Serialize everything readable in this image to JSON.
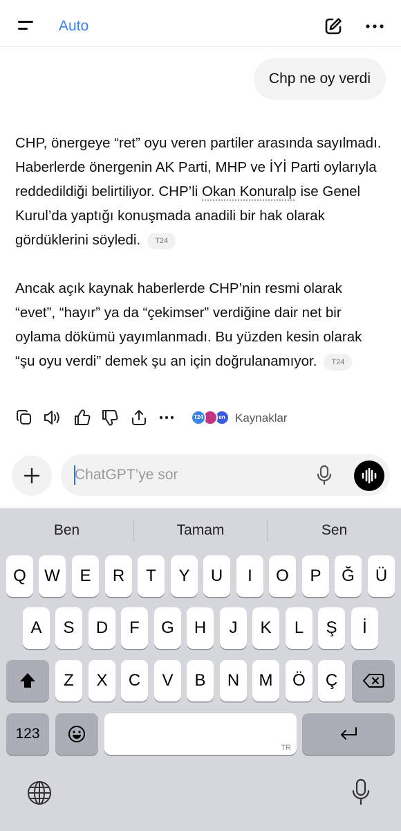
{
  "header": {
    "model_label": "Auto",
    "icons": {
      "menu": "menu-icon",
      "compose": "new-chat-icon",
      "more": "more-horizontal-icon"
    }
  },
  "conversation": {
    "user_message": "Chp ne oy verdi",
    "assistant": {
      "p1_text_a": "CHP, önergeye “ret” oyu veren partiler arasında sayılmadı. Haberlerde önergenin AK Parti, MHP ve İYİ Parti oylarıyla reddedildiği belirtiliyor. CHP’li ",
      "p1_link": "Okan Konuralp",
      "p1_text_b": " ise Genel Kurul’da yaptığı konuşmada anadili bir hak olarak gördüklerini söyledi.",
      "p1_cite": "T24",
      "p2_text": "Ancak açık kaynak haberlerde CHP’nin resmi olarak “evet”, “hayır” ya da “çekimser” verdiğine dair net bir oylama dökümü yayımlanmadı. Bu yüzden kesin olarak “şu oyu verdi” demek şu an için doğrulanamıyor.",
      "p2_cite": "T24"
    },
    "actions": {
      "icons": [
        "copy-icon",
        "read-aloud-icon",
        "thumbs-up-icon",
        "thumbs-down-icon",
        "share-icon",
        "more-icon"
      ],
      "sources_label": "Kaynaklar",
      "source_badges": [
        "T24",
        "",
        "en"
      ]
    }
  },
  "composer": {
    "placeholder": "ChatGPT’ye sor",
    "value": ""
  },
  "keyboard": {
    "suggestions": [
      "Ben",
      "Tamam",
      "Sen"
    ],
    "row1": [
      "Q",
      "W",
      "E",
      "R",
      "T",
      "Y",
      "U",
      "I",
      "O",
      "P",
      "Ğ",
      "Ü"
    ],
    "row2": [
      "A",
      "S",
      "D",
      "F",
      "G",
      "H",
      "J",
      "K",
      "L",
      "Ş",
      "İ"
    ],
    "row3": [
      "Z",
      "X",
      "C",
      "V",
      "B",
      "N",
      "M",
      "Ö",
      "Ç"
    ],
    "numbers_label": "123",
    "space_lang": "TR",
    "icons": {
      "shift": "shift-icon",
      "delete": "backspace-icon",
      "emoji": "emoji-icon",
      "return": "return-icon",
      "globe": "globe-icon",
      "dictation": "microphone-icon"
    }
  },
  "colors": {
    "accent": "#3b82f6",
    "bubble": "#f3f3f3",
    "keyboard_bg": "#d5d7dc",
    "key": "#ffffff",
    "fn_key": "#abaeb6"
  }
}
